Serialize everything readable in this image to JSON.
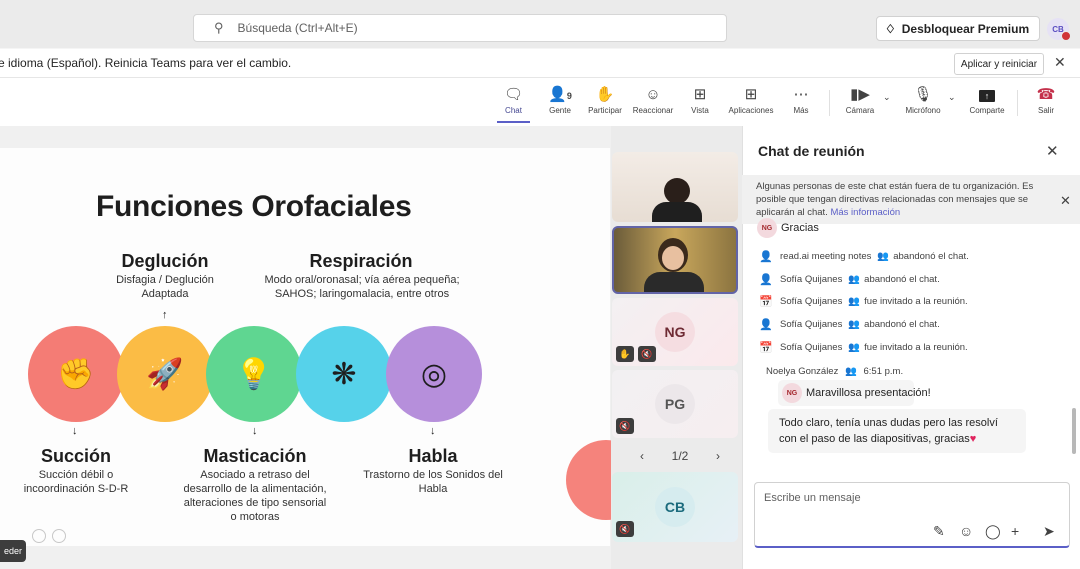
{
  "topbar": {
    "search_placeholder": "Búsqueda (Ctrl+Alt+E)",
    "premium_label": "Desbloquear Premium",
    "avatar_initials": "CB"
  },
  "notice": {
    "text": "e idioma (Español). Reinicia Teams para ver el cambio.",
    "apply_label": "Aplicar y reiniciar"
  },
  "toolbar": {
    "chat": "Chat",
    "people": "Gente",
    "people_count": "9",
    "raise": "Participar",
    "react": "Reaccionar",
    "view": "Vista",
    "apps": "Aplicaciones",
    "more": "Más",
    "camera": "Cámara",
    "mic": "Micrófono",
    "share": "Comparte",
    "leave": "Salir"
  },
  "slide": {
    "title": "Funciones Orofaciales",
    "functions": [
      {
        "title": "Deglución",
        "desc": "Disfagia / Deglución Adaptada"
      },
      {
        "title": "Respiración",
        "desc": "Modo oral/oronasal; vía aérea pequeña; SAHOS; laringomalacia, entre otros"
      },
      {
        "title": "Succión",
        "desc": "Succión débil o incoordinación S-D-R"
      },
      {
        "title": "Masticación",
        "desc": "Asociado a retraso del desarrollo de la alimentación, alteraciones de tipo sensorial o motoras"
      },
      {
        "title": "Habla",
        "desc": "Trastorno de los Sonidos del Habla"
      }
    ],
    "presenter_chip": "eder"
  },
  "participants": {
    "tiles": [
      {
        "initials": "NG"
      },
      {
        "initials": "PG"
      },
      {
        "initials": "CB"
      }
    ],
    "pager": "1/2"
  },
  "chat": {
    "title": "Chat de reunión",
    "warning": "Algunas personas de este chat están fuera de tu organización. Es posible que tengan directivas relacionadas con mensajes que se aplicarán al chat.",
    "warning_link": "Más información",
    "partial_msg": {
      "initials": "NG",
      "text": "Gracias"
    },
    "events": [
      {
        "name": "read.ai meeting notes",
        "action": "abandonó el chat."
      },
      {
        "name": "Sofía Quijanes",
        "action": "abandonó el chat."
      },
      {
        "name": "Sofía Quijanes",
        "action": "fue invitado a la reunión."
      },
      {
        "name": "Sofía Quijanes",
        "action": "abandonó el chat."
      },
      {
        "name": "Sofía Quijanes",
        "action": "fue invitado a la reunión."
      }
    ],
    "message": {
      "sender": "Noelya González",
      "time": "6:51 p.m.",
      "initials": "NG",
      "line1": "Maravillosa presentación!",
      "line2": "Todo claro, tenía unas dudas pero las resolví",
      "line3": "con el paso de las diapositivas, gracias"
    },
    "composer_placeholder": "Escribe un mensaje"
  }
}
